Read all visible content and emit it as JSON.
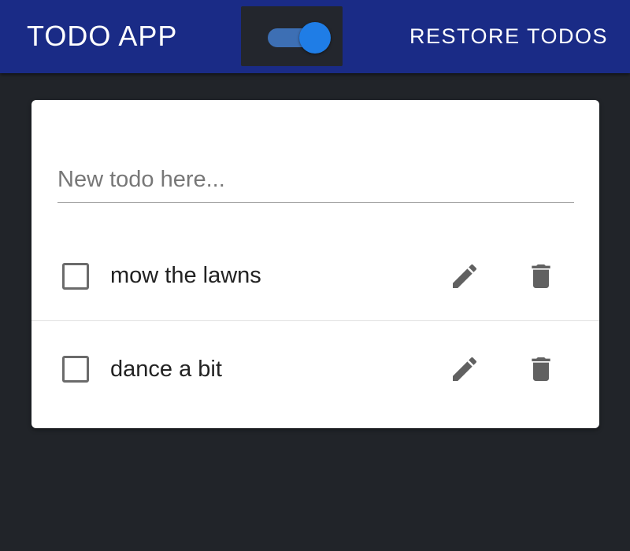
{
  "appbar": {
    "title": "TODO APP",
    "toggle_on": true,
    "restore_label": "RESTORE TODOS",
    "bar_color": "#1a2b86",
    "toggle_color": "#1f7de6"
  },
  "new_todo": {
    "placeholder": "New todo here...",
    "value": ""
  },
  "todos": [
    {
      "text": "mow the lawns",
      "checked": false,
      "edit_icon": "pencil-icon",
      "delete_icon": "trash-icon"
    },
    {
      "text": "dance a bit",
      "checked": false,
      "edit_icon": "pencil-icon",
      "delete_icon": "trash-icon"
    }
  ]
}
